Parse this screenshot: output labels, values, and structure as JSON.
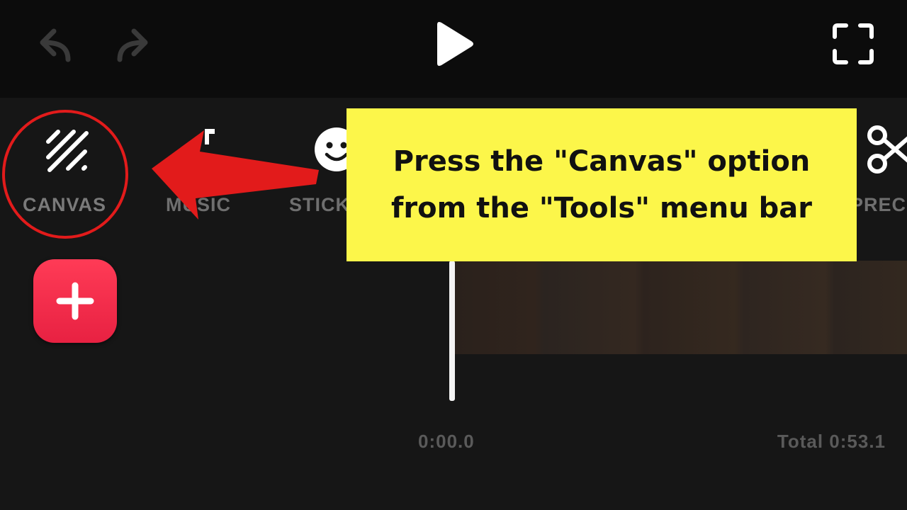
{
  "topbar": {
    "undo_icon": "undo-icon",
    "redo_icon": "redo-icon",
    "play_icon": "play-icon",
    "fullscreen_icon": "fullscreen-icon"
  },
  "tools": [
    {
      "id": "canvas",
      "label": "CANVAS",
      "icon": "canvas-icon"
    },
    {
      "id": "music",
      "label": "MUSIC",
      "icon": "music-icon"
    },
    {
      "id": "sticker",
      "label": "STICK",
      "icon": "sticker-icon"
    },
    {
      "id": "precut",
      "label": "PREC",
      "icon": "scissors-icon"
    }
  ],
  "add_button": {
    "icon": "plus-icon"
  },
  "timeline": {
    "current_time": "0:00.0",
    "total_time": "Total 0:53.1"
  },
  "annotation": {
    "callout_text": "Press the \"Canvas\" option\nfrom the \"Tools\" menu bar",
    "arrow_color": "#e21b1b",
    "callout_color": "#fcf64a"
  },
  "colors": {
    "background": "#161616",
    "topbar": "#0c0c0c",
    "accent": "#ff3b56",
    "highlight": "#e21b1b"
  }
}
